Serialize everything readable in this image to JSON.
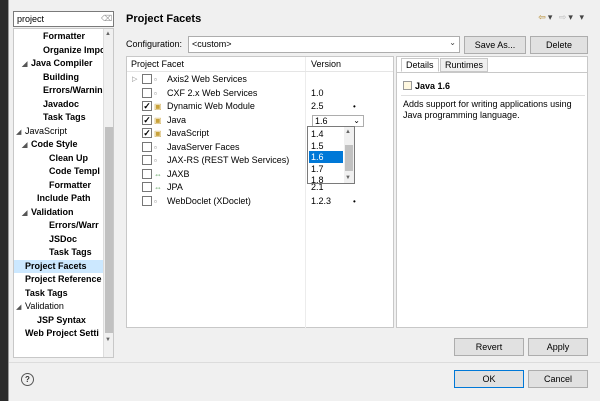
{
  "filter": {
    "value": "project",
    "clear_icon": "clear-icon"
  },
  "tree": [
    {
      "label": "Formatter",
      "bold": true,
      "indent": 3
    },
    {
      "label": "Organize Impo",
      "bold": true,
      "indent": 3
    },
    {
      "label": "Java Compiler",
      "bold": true,
      "indent": 1,
      "tri": "◢"
    },
    {
      "label": "Building",
      "bold": true,
      "indent": 3
    },
    {
      "label": "Errors/Warnin",
      "bold": true,
      "indent": 3
    },
    {
      "label": "Javadoc",
      "bold": true,
      "indent": 3
    },
    {
      "label": "Task Tags",
      "bold": true,
      "indent": 3
    },
    {
      "label": "JavaScript",
      "bold": false,
      "indent": 0,
      "tri": "◢"
    },
    {
      "label": "Code Style",
      "bold": true,
      "indent": 1,
      "tri": "◢"
    },
    {
      "label": "Clean Up",
      "bold": true,
      "indent": 4
    },
    {
      "label": "Code Templ",
      "bold": true,
      "indent": 4
    },
    {
      "label": "Formatter",
      "bold": true,
      "indent": 4
    },
    {
      "label": "Include Path",
      "bold": true,
      "indent": 2
    },
    {
      "label": "Validation",
      "bold": true,
      "indent": 1,
      "tri": "◢"
    },
    {
      "label": "Errors/Warr",
      "bold": true,
      "indent": 4
    },
    {
      "label": "JSDoc",
      "bold": true,
      "indent": 4
    },
    {
      "label": "Task Tags",
      "bold": true,
      "indent": 4
    },
    {
      "label": "Project Facets",
      "bold": true,
      "indent": 0,
      "selected": true
    },
    {
      "label": "Project Reference",
      "bold": true,
      "indent": 0
    },
    {
      "label": "Task Tags",
      "bold": true,
      "indent": 0
    },
    {
      "label": "Validation",
      "bold": false,
      "indent": 0,
      "tri": "◢"
    },
    {
      "label": "JSP Syntax",
      "bold": true,
      "indent": 2
    },
    {
      "label": "Web Project Setti",
      "bold": true,
      "indent": 0
    }
  ],
  "title": "Project Facets",
  "config": {
    "label": "Configuration:",
    "value": "<custom>",
    "save_as": "Save As...",
    "delete": "Delete"
  },
  "facets": {
    "col_facet": "Project Facet",
    "col_version": "Version",
    "rows": [
      {
        "name": "Axis2 Web Services",
        "version": "",
        "checked": false,
        "expandable": true,
        "icon": "▫"
      },
      {
        "name": "CXF 2.x Web Services",
        "version": "1.0",
        "checked": false,
        "icon": "▫"
      },
      {
        "name": "Dynamic Web Module",
        "version": "2.5",
        "checked": true,
        "icon": "▣",
        "dot": "•"
      },
      {
        "name": "Java",
        "version": "1.6",
        "checked": true,
        "icon": "▣",
        "selected": true
      },
      {
        "name": "JavaScript",
        "version": "",
        "checked": true,
        "icon": "▣"
      },
      {
        "name": "JavaServer Faces",
        "version": "",
        "checked": false,
        "icon": "▫"
      },
      {
        "name": "JAX-RS (REST Web Services)",
        "version": "",
        "checked": false,
        "icon": "▫"
      },
      {
        "name": "JAXB",
        "version": "",
        "checked": false,
        "icon": "⇔"
      },
      {
        "name": "JPA",
        "version": "2.1",
        "checked": false,
        "icon": "⇔"
      },
      {
        "name": "WebDoclet (XDoclet)",
        "version": "1.2.3",
        "checked": false,
        "icon": "▫",
        "dot": "•"
      }
    ]
  },
  "dropdown": {
    "options": [
      "1.4",
      "1.5",
      "1.6",
      "1.7",
      "1.8"
    ],
    "selected": "1.6"
  },
  "details": {
    "tab_details": "Details",
    "tab_runtimes": "Runtimes",
    "facet_title": "Java 1.6",
    "description": "Adds support for writing applications using Java programming language."
  },
  "buttons": {
    "revert": "Revert",
    "apply": "Apply",
    "ok": "OK",
    "cancel": "Cancel"
  },
  "help_glyph": "?",
  "colors": {
    "selection": "#0078d7",
    "tree_selection": "#cce8ff"
  }
}
